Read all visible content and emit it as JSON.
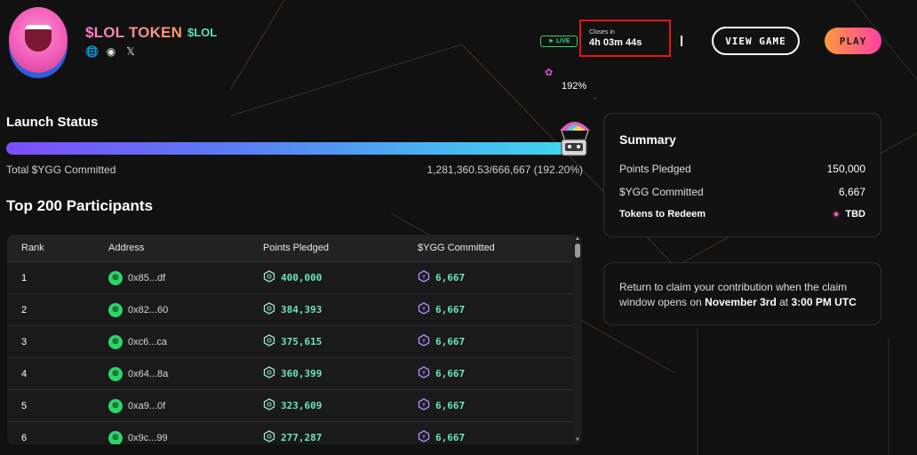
{
  "token": {
    "name": "$LOL TOKEN",
    "ticker": "$LOL",
    "socials": [
      {
        "name": "website",
        "glyph": "🌐"
      },
      {
        "name": "discord",
        "glyph": "◉"
      },
      {
        "name": "x",
        "glyph": "𝕏"
      }
    ]
  },
  "status": {
    "live_label": "LIVE",
    "closes_label": "Closes in",
    "closes_time": "4h 03m 44s"
  },
  "buttons": {
    "view_game": "VIEW GAME",
    "play": "PLAY"
  },
  "launch": {
    "title": "Launch Status",
    "percent_badge": "192%",
    "progress_fraction": 1.0,
    "total_label": "Total $YGG Committed",
    "total_value": "1,281,360.53/666,667 (192.20%)"
  },
  "participants": {
    "title": "Top 200 Participants",
    "columns": [
      "Rank",
      "Address",
      "Points Pledged",
      "$YGG Committed"
    ],
    "rows": [
      {
        "rank": "1",
        "address": "0x85...df",
        "points": "400,000",
        "ygg": "6,667"
      },
      {
        "rank": "2",
        "address": "0x82...60",
        "points": "384,393",
        "ygg": "6,667"
      },
      {
        "rank": "3",
        "address": "0xc6...ca",
        "points": "375,615",
        "ygg": "6,667"
      },
      {
        "rank": "4",
        "address": "0x64...8a",
        "points": "360,399",
        "ygg": "6,667"
      },
      {
        "rank": "5",
        "address": "0xa9...0f",
        "points": "323,609",
        "ygg": "6,667"
      },
      {
        "rank": "6",
        "address": "0x9c...99",
        "points": "277,287",
        "ygg": "6,667"
      }
    ]
  },
  "summary": {
    "title": "Summary",
    "points_label": "Points Pledged",
    "points_value": "150,000",
    "ygg_label": "$YGG Committed",
    "ygg_value": "6,667",
    "redeem_label": "Tokens to Redeem",
    "redeem_value": "TBD"
  },
  "claim": {
    "text_before": "Return to claim your contribution when the claim window opens on ",
    "date": "November 3rd",
    "text_mid": " at ",
    "time": "3:00 PM UTC"
  },
  "colors": {
    "accent_green": "#6ae7b6",
    "live_green": "#3bd16f",
    "highlight_red": "#e41414",
    "play_gradient_start": "#ff9a3c",
    "play_gradient_end": "#ff3fa4"
  }
}
